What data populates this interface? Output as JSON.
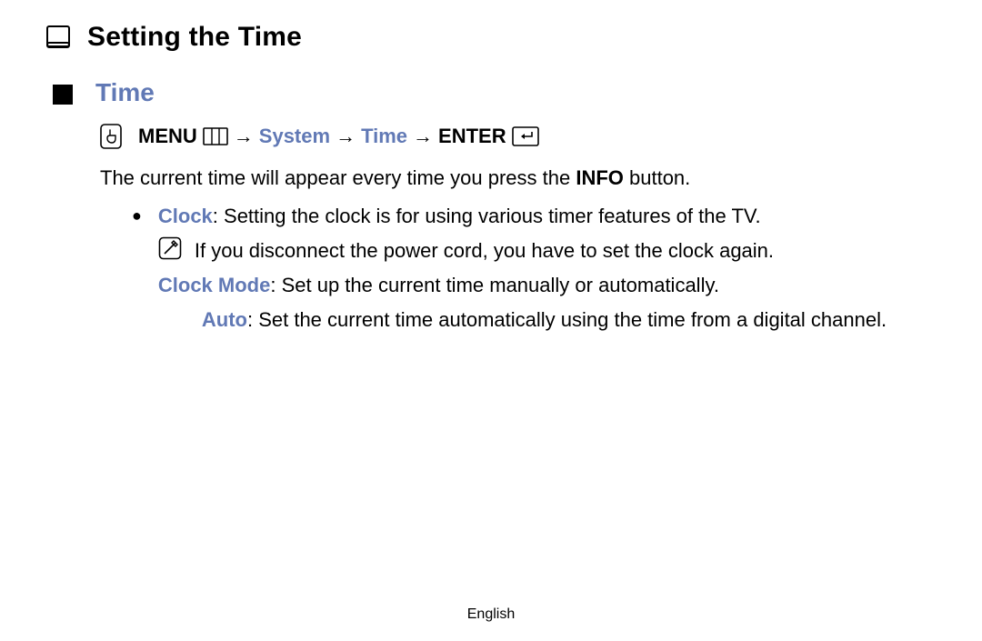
{
  "heading": "Setting the Time",
  "section": "Time",
  "path": {
    "menu": "MENU",
    "system": "System",
    "time": "Time",
    "enter": "ENTER",
    "arrow": "→"
  },
  "intro_pre": "The current time will appear every time you press the ",
  "intro_bold": "INFO",
  "intro_post": " button.",
  "clock_label": "Clock",
  "clock_desc": ": Setting the clock is for using various timer features of the TV.",
  "note_text": "If you disconnect the power cord, you have to set the clock again.",
  "clockmode_label": "Clock Mode",
  "clockmode_desc": ": Set up the current time manually or automatically.",
  "auto_label": "Auto",
  "auto_desc": ": Set the current time automatically using the time from a digital channel.",
  "footer": "English"
}
